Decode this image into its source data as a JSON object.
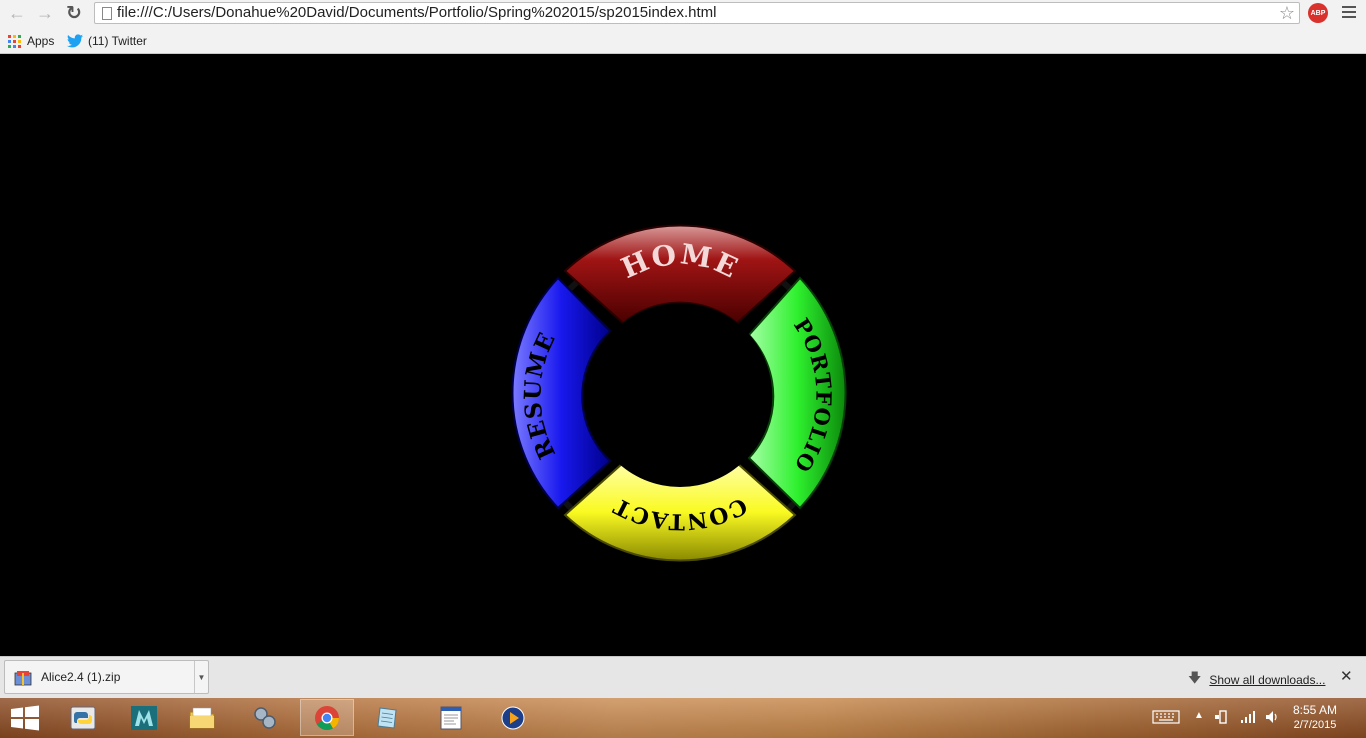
{
  "browser": {
    "url": "file:///C:/Users/Donahue%20David/Documents/Portfolio/Spring%202015/sp2015index.html",
    "abp_label": "ABP",
    "bookmarks": [
      {
        "label": "Apps",
        "icon": "apps-grid-icon"
      },
      {
        "label": "(11) Twitter",
        "icon": "twitter-bird-icon"
      }
    ]
  },
  "page": {
    "background": "#000000",
    "nav_ring": [
      {
        "label": "HOME",
        "color": "#8b0a0a",
        "text_color": "#f4d9d9"
      },
      {
        "label": "PORTFOLIO",
        "color": "#1ee01e",
        "text_color": "#000000"
      },
      {
        "label": "CONTACT",
        "color": "#f5f51a",
        "text_color": "#000000"
      },
      {
        "label": "RESUME",
        "color": "#1a1ae8",
        "text_color": "#000000"
      }
    ]
  },
  "downloads": {
    "item_name": "Alice2.4 (1).zip",
    "show_all_label": "Show all downloads..."
  },
  "taskbar": {
    "apps": [
      "python-icon",
      "maya-icon",
      "file-explorer-icon",
      "network-icon",
      "chrome-icon",
      "notepad-icon",
      "text-editor-icon",
      "media-player-icon"
    ],
    "active_app": "chrome-icon",
    "time": "8:55 AM",
    "date": "2/7/2015"
  }
}
